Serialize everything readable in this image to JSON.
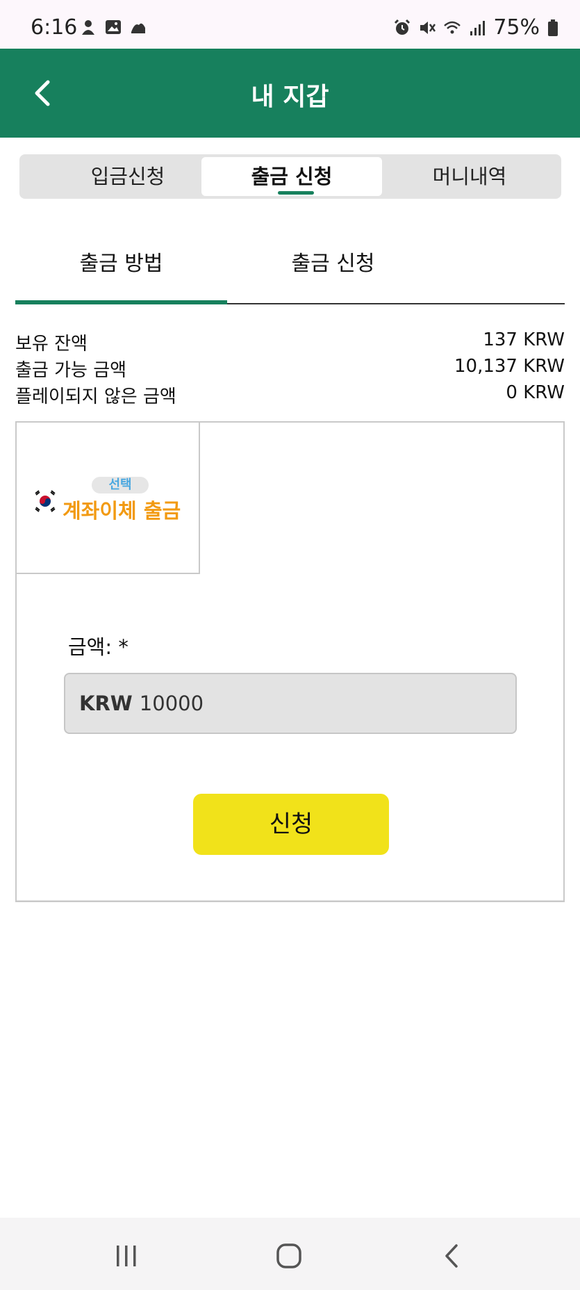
{
  "status_bar": {
    "time": "6:16",
    "battery_text": "75%"
  },
  "header": {
    "title": "내 지갑"
  },
  "segment_tabs": [
    {
      "label": "입금신청"
    },
    {
      "label": "출금 신청",
      "active": true
    },
    {
      "label": "머니내역"
    }
  ],
  "sub_tabs": [
    {
      "label": "출금 방법",
      "active": true
    },
    {
      "label": "출금 신청"
    }
  ],
  "balances": [
    {
      "label": "보유 잔액",
      "value": "137 KRW"
    },
    {
      "label": "출금 가능 금액",
      "value": "10,137 KRW"
    },
    {
      "label": "플레이되지 않은 금액",
      "value": "0 KRW"
    }
  ],
  "method_card": {
    "badge": "선택",
    "label": "계좌이체 출금"
  },
  "form": {
    "amount_label": "금액: *",
    "currency": "KRW",
    "amount_value": "10000",
    "submit_label": "신청"
  },
  "colors": {
    "primary_green": "#17805d",
    "submit_yellow": "#f1e21a",
    "method_orange": "#f29a12",
    "badge_blue": "#4aa8e0"
  }
}
